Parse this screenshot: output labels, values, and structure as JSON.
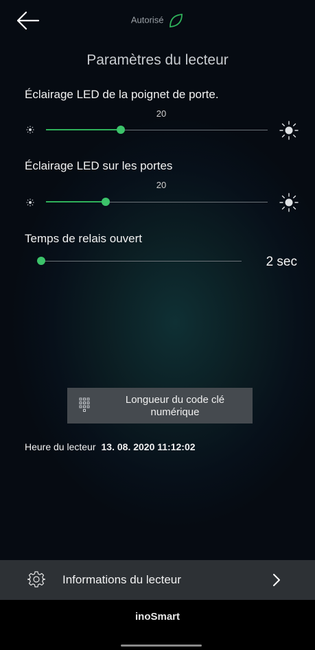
{
  "status": {
    "text": "Autorisé",
    "icon": "leaf-icon"
  },
  "title": "Paramètres du lecteur",
  "settings": {
    "handle_led": {
      "label": "Éclairage LED de la poignet de porte.",
      "value": "20"
    },
    "door_led": {
      "label": "Éclairage LED sur les portes",
      "value": "20"
    },
    "relay": {
      "label": "Temps de relais ouvert",
      "value": "2 sec"
    }
  },
  "code_button": {
    "label": "Longueur du code clé numérique",
    "icon": "keypad-icon"
  },
  "reader_time": {
    "label": "Heure du lecteur",
    "value": "13. 08. 2020 11:12:02"
  },
  "info": {
    "label": "Informations du lecteur",
    "icon": "gear-icon"
  },
  "brand": "inoSmart",
  "colors": {
    "accent": "#3cc36a",
    "button": "#454a4f",
    "info_bar": "#2d3135"
  }
}
